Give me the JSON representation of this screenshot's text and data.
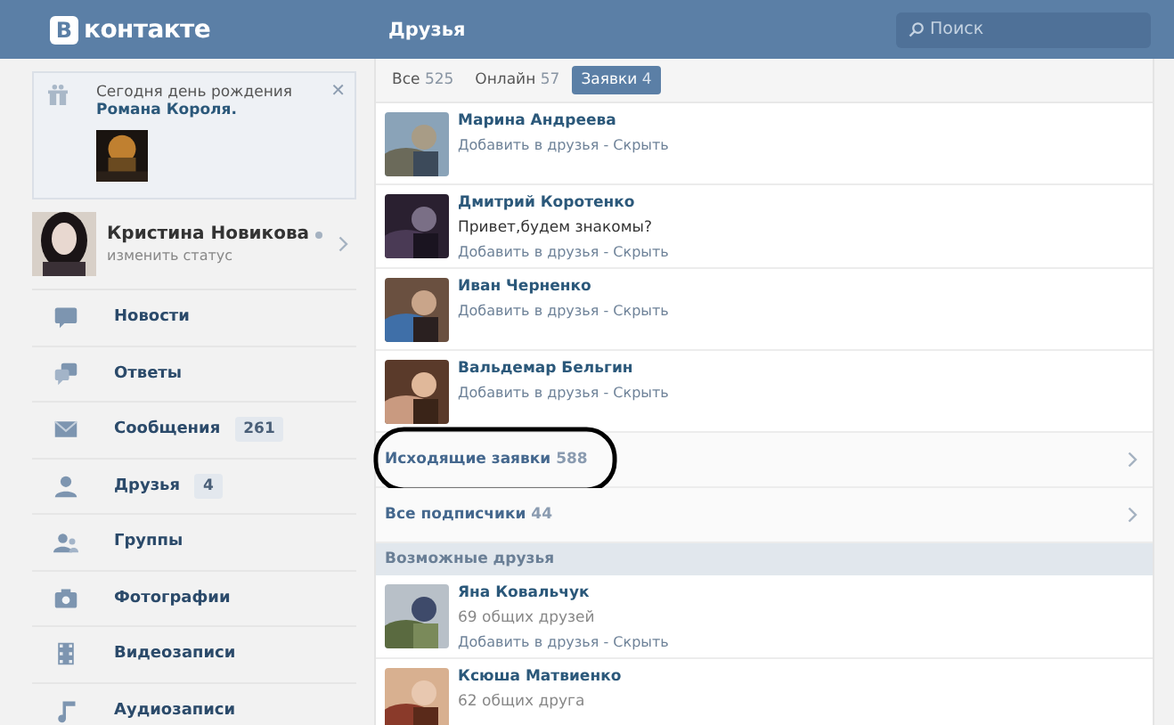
{
  "header": {
    "logo_letter": "В",
    "logo_text": "контакте",
    "title": "Друзья",
    "search": {
      "placeholder": "Поиск"
    }
  },
  "birthday": {
    "text": "Сегодня день рождения",
    "name": "Романа Короля.",
    "close": "✕"
  },
  "profile": {
    "name": "Кристина Новикова",
    "status": "изменить статус",
    "online": true
  },
  "menu": [
    {
      "label": "Новости",
      "kind": "news"
    },
    {
      "label": "Ответы",
      "kind": "replies"
    },
    {
      "label": "Сообщения",
      "kind": "mail",
      "count": "261"
    },
    {
      "label": "Друзья",
      "kind": "person",
      "count": "4"
    },
    {
      "label": "Группы",
      "kind": "group"
    },
    {
      "label": "Фотографии",
      "kind": "camera"
    },
    {
      "label": "Видеозаписи",
      "kind": "film"
    },
    {
      "label": "Аудиозаписи",
      "kind": "note"
    }
  ],
  "tabs": [
    {
      "label": "Все",
      "count": "525",
      "selected": false
    },
    {
      "label": "Онлайн",
      "count": "57",
      "selected": false
    },
    {
      "label": "Заявки",
      "count": "4",
      "selected": true
    }
  ],
  "requests": [
    {
      "name": "Марина Андреева",
      "actions": "Добавить в друзья - Скрыть"
    },
    {
      "name": "Дмитрий Коротенко",
      "message": "Привет,будем знакомы?",
      "actions": "Добавить в друзья - Скрыть"
    },
    {
      "name": "Иван Черненко",
      "actions": "Добавить в друзья - Скрыть"
    },
    {
      "name": "Вальдемар Бельгин",
      "actions": "Добавить в друзья - Скрыть"
    }
  ],
  "links": [
    {
      "label": "Исходящие заявки",
      "count": "588",
      "circled": true
    },
    {
      "label": "Все подписчики",
      "count": "44",
      "circled": false
    }
  ],
  "suggestions": {
    "title": "Возможные друзья",
    "items": [
      {
        "name": "Яна Ковальчук",
        "mutual": "69 общих друзей",
        "actions": "Добавить в друзья - Скрыть"
      },
      {
        "name": "Ксюша Матвиенко",
        "mutual": "62 общих друга"
      }
    ]
  }
}
